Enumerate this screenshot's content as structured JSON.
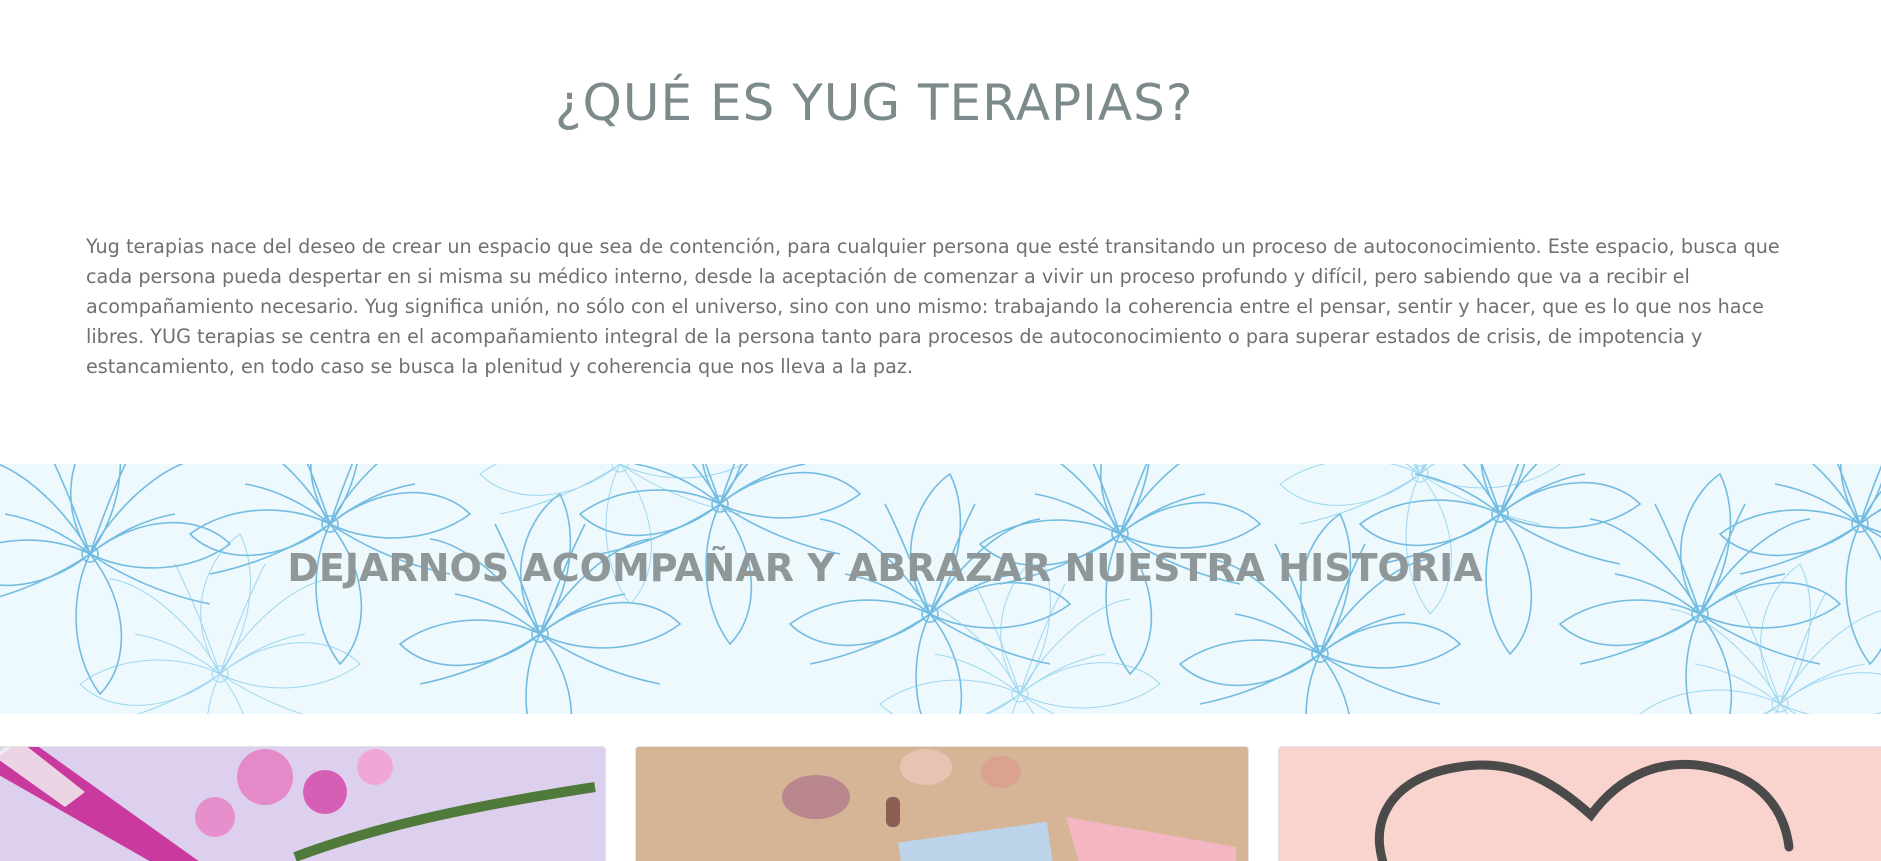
{
  "about": {
    "title": "¿QUÉ ES YUG TERAPIAS?",
    "text": "Yug terapias nace del deseo de crear un espacio que sea de contención, para cualquier persona que esté transitando un proceso de autoconocimiento. Este espacio, busca que cada persona pueda despertar en si misma su médico interno, desde la aceptación de comenzar a vivir un proceso profundo y difícil, pero sabiendo que va a recibir el acompañamiento necesario. Yug significa unión, no sólo con el universo, sino con uno mismo: trabajando la coherencia entre el pensar, sentir y hacer, que es lo que nos hace libres. YUG terapias se centra en el acompañamiento integral de la persona tanto para procesos de autoconocimiento o para superar estados de crisis, de impotencia y estancamiento, en todo caso se busca la plenitud y coherencia que nos lleva a la paz."
  },
  "banner": {
    "text": "DEJARNOS ACOMPAÑAR Y ABRAZAR NUESTRA HISTORIA",
    "pattern_color": "#4aa8d8"
  },
  "cards": [
    {
      "name": "flowers-essence-photo",
      "bg": "#dcd0ef"
    },
    {
      "name": "crystals-photo",
      "bg": "#d9b79b"
    },
    {
      "name": "heart-drawing-photo",
      "bg": "#f9d3cf"
    }
  ]
}
